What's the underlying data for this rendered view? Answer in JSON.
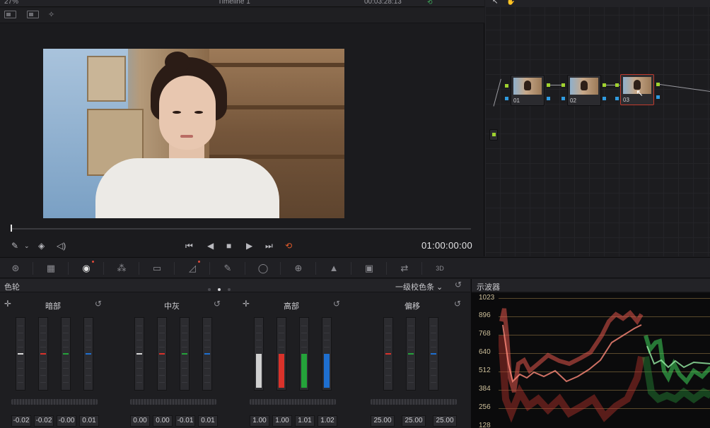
{
  "topbar": {
    "zoom": "27%",
    "timeline_name": "Timeline 1",
    "timecode_top": "00:03:28:13"
  },
  "transport": {
    "timecode": "01:00:00:00"
  },
  "nodes": [
    {
      "label": "01"
    },
    {
      "label": "02"
    },
    {
      "label": "03"
    }
  ],
  "wheels_panel": {
    "title": "色轮",
    "mode": "一级校色条",
    "wheels": [
      {
        "name": "暗部",
        "values": [
          "-0.02",
          "-0.02",
          "-0.00",
          "0.01"
        ]
      },
      {
        "name": "中灰",
        "values": [
          "0.00",
          "0.00",
          "-0.01",
          "0.01"
        ]
      },
      {
        "name": "高部",
        "values": [
          "1.00",
          "1.00",
          "1.01",
          "1.02"
        ]
      },
      {
        "name": "偏移",
        "values": [
          "25.00",
          "25.00",
          "25.00"
        ]
      }
    ]
  },
  "scopes": {
    "title": "示波器",
    "y_labels": [
      "1023",
      "896",
      "768",
      "640",
      "512",
      "384",
      "256",
      "128"
    ]
  },
  "colors": {
    "red_channel": "#d9322a",
    "green_channel": "#24a23a",
    "blue_channel": "#1e6fd0",
    "selection_red": "#c23b2e",
    "loop_orange": "#e05a2b"
  },
  "icons": {
    "play": "▶",
    "stop": "■",
    "prev": "◀",
    "first": "⏮",
    "last": "⏭",
    "loop": "⟲",
    "reset": "↺"
  }
}
